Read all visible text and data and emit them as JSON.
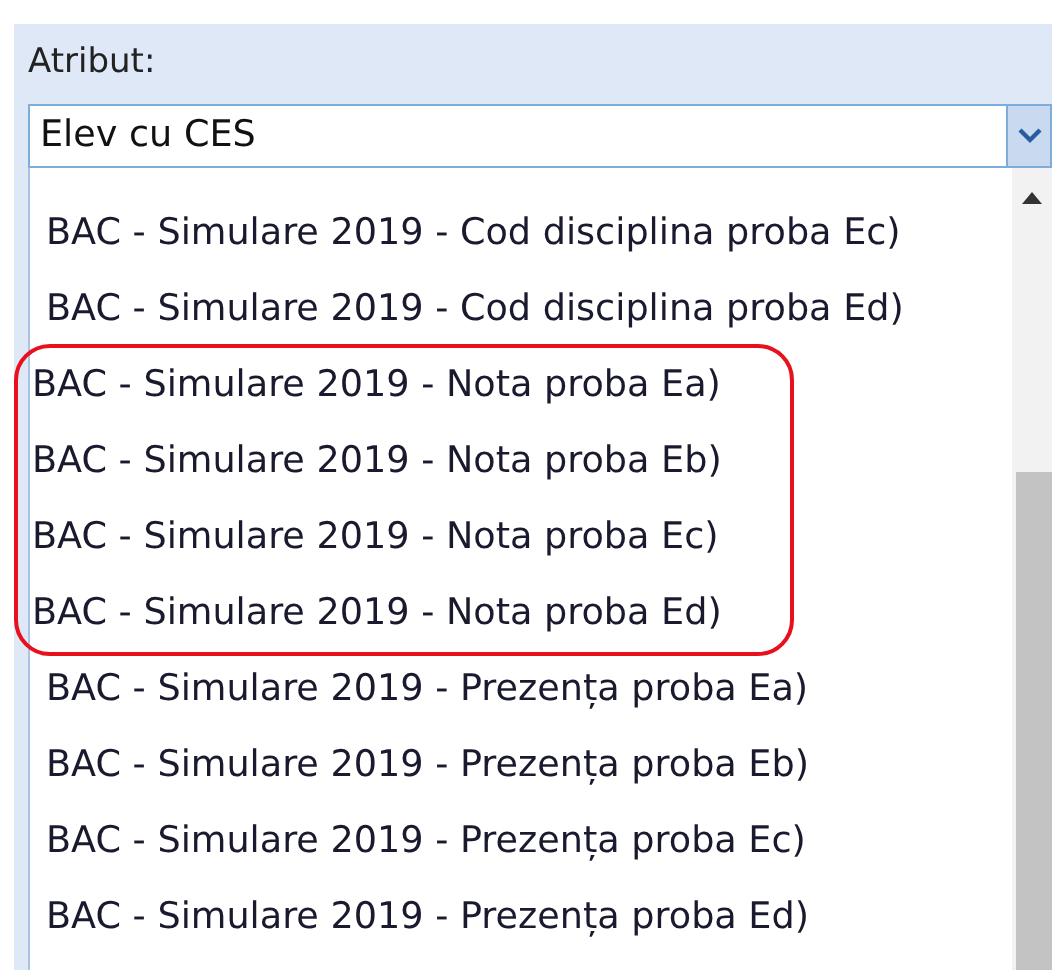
{
  "field": {
    "label": "Atribut:",
    "value": "Elev cu CES"
  },
  "dropdown": {
    "items": [
      {
        "text": "BAC - Simulare 2019 - Cod disciplina proba Ec)",
        "circled": false
      },
      {
        "text": "BAC - Simulare 2019 - Cod disciplina proba Ed)",
        "circled": false
      },
      {
        "text": "BAC - Simulare 2019 - Nota proba Ea)",
        "circled": true
      },
      {
        "text": "BAC - Simulare 2019 - Nota proba Eb)",
        "circled": true
      },
      {
        "text": "BAC - Simulare 2019 - Nota proba Ec)",
        "circled": true
      },
      {
        "text": "BAC - Simulare 2019 - Nota proba Ed)",
        "circled": true
      },
      {
        "text": "BAC - Simulare 2019 - Prezența proba Ea)",
        "circled": false
      },
      {
        "text": "BAC - Simulare 2019 - Prezența proba Eb)",
        "circled": false
      },
      {
        "text": "BAC - Simulare 2019 - Prezența proba Ec)",
        "circled": false
      },
      {
        "text": "BAC - Simulare 2019 - Prezența proba Ed)",
        "circled": false
      }
    ]
  }
}
